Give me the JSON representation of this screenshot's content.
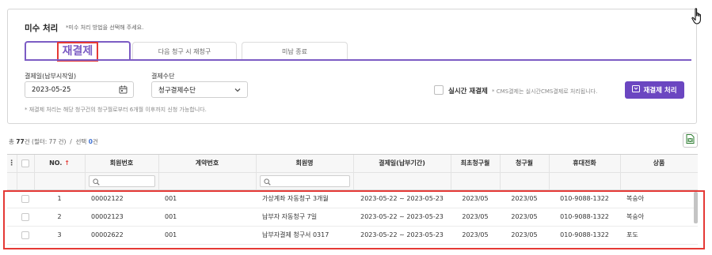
{
  "section": {
    "title": "미수 처리",
    "subtitle": "*미수 처리 방법을 선택해 주세요."
  },
  "tabs": [
    {
      "label": "재결제",
      "active": true
    },
    {
      "label": "다음 청구 시 재청구",
      "active": false
    },
    {
      "label": "미납 종료",
      "active": false
    }
  ],
  "form": {
    "payment_date_label": "결제일(납부시작일)",
    "payment_date_value": "2023-05-25",
    "payment_method_label": "결제수단",
    "payment_method_value": "청구결제수단",
    "realtime_label": "실시간 재결제",
    "realtime_note": "* CMS결제는 실시간CMS결제로 처리됩니다.",
    "submit_label": "재결제 처리",
    "hint": "* 재결제 처리는 해당 청구건의 청구월로부터 6개월 이후까지 신청 가능합니다."
  },
  "summary": {
    "total_prefix": "총",
    "total_count": "77",
    "total_suffix": "건 (필터: 77 건)",
    "separator": "/",
    "selected_prefix": "선택",
    "selected_count": "0",
    "selected_suffix": "건"
  },
  "table": {
    "columns": [
      "NO.",
      "회원번호",
      "계약번호",
      "회원명",
      "결제일(납부기간)",
      "최초청구월",
      "청구월",
      "휴대전화",
      "상품"
    ],
    "sort_mark": "↑",
    "rows": [
      {
        "no": "1",
        "member_no": "00002122",
        "contract_no": "001",
        "member_name": "가상계좌 자동청구 3개월",
        "period": "2023-05-22 ~ 2023-05-23",
        "first_month": "2023/05",
        "bill_month": "2023/05",
        "phone": "010-9088-1322",
        "product": "복숭아"
      },
      {
        "no": "2",
        "member_no": "00002123",
        "contract_no": "001",
        "member_name": "납부자 자동청구 7일",
        "period": "2023-05-22 ~ 2023-05-23",
        "first_month": "2023/05",
        "bill_month": "2023/05",
        "phone": "010-9088-1322",
        "product": "복숭아"
      },
      {
        "no": "3",
        "member_no": "00002622",
        "contract_no": "001",
        "member_name": "납부자결제 청구서 0317",
        "period": "2023-05-22 ~ 2023-05-23",
        "first_month": "2023/05",
        "bill_month": "2023/05",
        "phone": "010-9088-1322",
        "product": "포도"
      }
    ]
  },
  "colors": {
    "accent": "#6b46c1",
    "tab_accent": "#7c5cc4",
    "highlight": "#e53935",
    "selected_count": "#3b6fd4"
  }
}
